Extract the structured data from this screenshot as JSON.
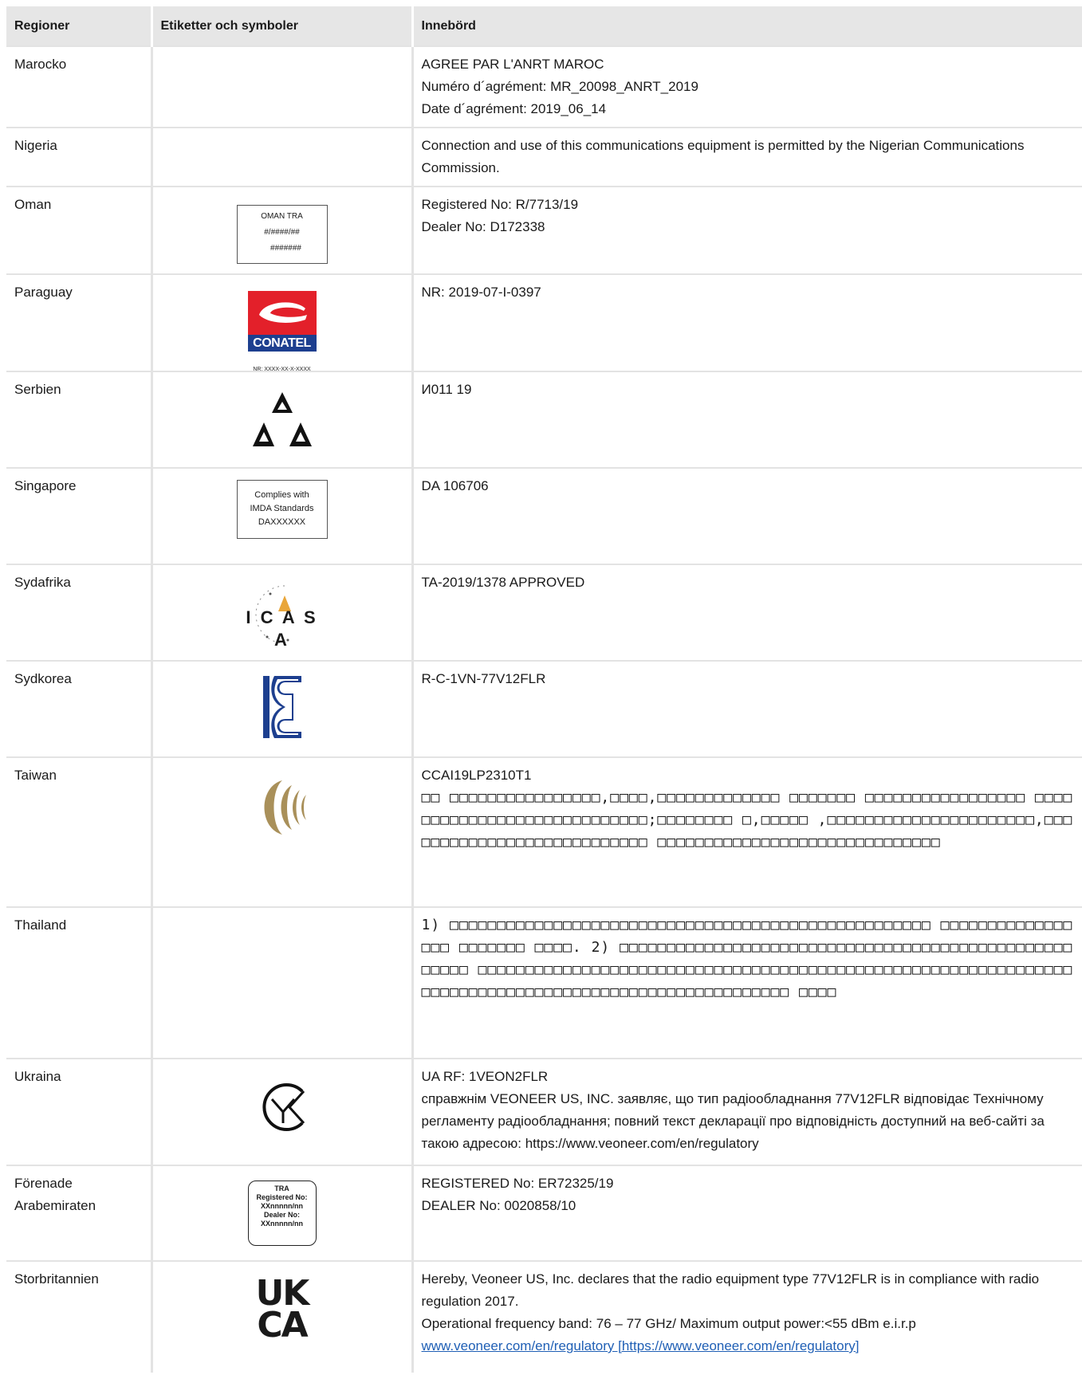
{
  "table": {
    "headers": [
      "Regioner",
      "Etiketter och symboler",
      "Innebörd"
    ],
    "rows": [
      {
        "region": "Marocko",
        "lines": [
          "AGREE PAR L'ANRT MAROC",
          "Numéro d´agrément: MR_20098_ANRT_2019",
          "Date d´agrément: 2019_06_14"
        ]
      },
      {
        "region": "Nigeria",
        "lines": [
          "Connection and use of this communications equipment is permitted by the Nigerian Communications Commission."
        ]
      },
      {
        "region": "Oman",
        "symbol": {
          "icon": "oman-tra-label",
          "lines": [
            "OMAN TRA",
            "#/####/##",
            "#######"
          ]
        },
        "lines": [
          "Registered No: R/7713/19",
          "Dealer No: D172338"
        ]
      },
      {
        "region": "Paraguay",
        "symbol": {
          "icon": "conatel-logo",
          "lines": [
            "CONATEL",
            "NR: XXXX-XX-X-XXXX"
          ]
        },
        "lines": [
          "NR: 2019-07-I-0397"
        ]
      },
      {
        "region": "Serbien",
        "symbol": {
          "icon": "serbia-triangles-logo"
        },
        "lines": [
          "И011 19"
        ]
      },
      {
        "region": "Singapore",
        "symbol": {
          "icon": "imda-label",
          "lines": [
            "Complies with",
            "IMDA Standards",
            "DAXXXXXX"
          ]
        },
        "lines": [
          "DA 106706"
        ]
      },
      {
        "region": "Sydafrika",
        "symbol": {
          "icon": "icasa-logo",
          "lines": [
            "I C A S A"
          ]
        },
        "lines": [
          "TA-2019/1378 APPROVED"
        ]
      },
      {
        "region": "Sydkorea",
        "symbol": {
          "icon": "kc-mark-logo"
        },
        "lines": [
          "R-C-1VN-77V12FLR"
        ]
      },
      {
        "region": "Taiwan",
        "symbol": {
          "icon": "ncc-logo"
        },
        "lines": [
          "CCAI19LP2310T1",
          "□□ □□□□□□□□□□□□□□□□,□□□□,□□□□□□□□□□□□□ □□□□□□□ □□□□□□□□□□□□□□□□□ □□□□□□□□□□□□□□□□□□□□□□□□□□□□;□□□□□□□□ □,□□□□□ ,□□□□□□□□□□□□□□□□□□□□□□,□□□□□□□□□□□□□□□□□□□□□□□□□□□ □□□□□□□□□□□□□□□□□□□□□□□□□□□□□□"
        ]
      },
      {
        "region": "Thailand",
        "lines": [
          "1) □□□□□□□□□□□□□□□□□□□□□□□□□□□□□□□□□□□□□□□□□□□□□□□□□□□ □□□□□□□□□□□□□□□□□ □□□□□□□ □□□□. 2) □□□□□□□□□□□□□□□□□□□□□□□□□□□□□□□□□□□□□□□□□□□□□□□□□□□□□ □□□□□□□□□□□□□□□□□□□□□□□□□□□□□□□□□□□□□□□□□□□□□□□□□□□□□□□□□□□□□□□□□□□□□□□□□□□□□□□□□□□□□□□□□□□□□□□□□□□□□□ □□□□"
        ]
      },
      {
        "region": "Ukraina",
        "symbol": {
          "icon": "ukraine-conformity-mark"
        },
        "lines": [
          "UA RF: 1VEON2FLR",
          "справжнім VEONEER US, INC. заявляє, що тип радіообладнання 77V12FLR відповідає Технічному регламенту радіообладнання; повний текст декларації про відповідність доступний на веб-сайті за такою адресою: https://www.veoneer.com/en/regulatory"
        ]
      },
      {
        "region": "Förenade Arabemiraten",
        "symbol": {
          "icon": "uae-tra-label",
          "lines": [
            "TRA",
            "Registered No:",
            "XXnnnnn/nn",
            "Dealer No:",
            "XXnnnnn/nn"
          ]
        },
        "lines": [
          "REGISTERED No: ER72325/19",
          "DEALER No: 0020858/10"
        ]
      },
      {
        "region": "Storbritannien",
        "symbol": {
          "icon": "ukca-mark",
          "lines": [
            "UK",
            "CA"
          ]
        },
        "lines": [
          "Hereby, Veoneer US, Inc. declares that the radio equipment type 77V12FLR is in compliance with radio regulation 2017.",
          "Operational frequency band: 76 – 77 GHz/ Maximum output power:<55 dBm e.i.r.p"
        ],
        "link": "www.veoneer.com/en/regulatory [https://www.veoneer.com/en/regulatory]"
      }
    ]
  }
}
